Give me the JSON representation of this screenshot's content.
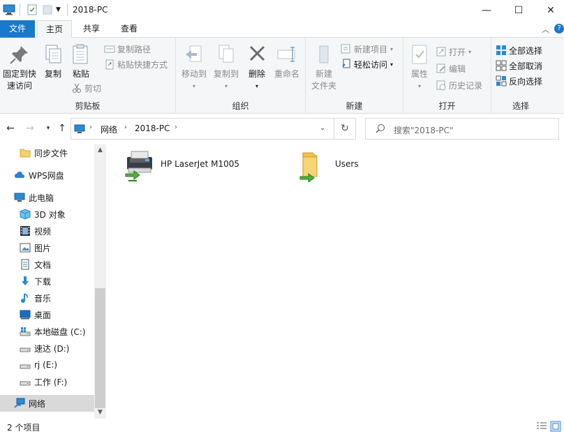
{
  "window": {
    "title": "2018-PC",
    "minimize": "—",
    "maximize": "☐",
    "close": "✕"
  },
  "ribbon_tabs": {
    "file": "文件",
    "home": "主页",
    "share": "共享",
    "view": "查看"
  },
  "clipboard": {
    "pin": "固定到快速访问",
    "pin_line1": "固定到快",
    "pin_line2": "速访问",
    "copy": "复制",
    "paste": "粘贴",
    "copy_path": "复制路径",
    "paste_shortcut": "粘贴快捷方式",
    "cut": "剪切",
    "group": "剪贴板"
  },
  "organize": {
    "move_to": "移动到",
    "copy_to": "复制到",
    "delete": "删除",
    "rename": "重命名",
    "group": "组织"
  },
  "new": {
    "new_folder_line1": "新建",
    "new_folder_line2": "文件夹",
    "new_item": "新建项目",
    "easy_access": "轻松访问",
    "group": "新建"
  },
  "open": {
    "properties": "属性",
    "open": "打开",
    "edit": "编辑",
    "history": "历史记录",
    "group": "打开"
  },
  "select": {
    "select_all": "全部选择",
    "select_none": "全部取消",
    "invert": "反向选择",
    "group": "选择"
  },
  "address": {
    "crumbs": [
      "网络",
      "2018-PC"
    ]
  },
  "search": {
    "placeholder": "搜索\"2018-PC\""
  },
  "nav_pane": {
    "items": [
      {
        "label": "同步文件",
        "icon": "folder-icon"
      },
      {
        "label": "WPS网盘",
        "icon": "cloud-icon"
      },
      {
        "label": "此电脑",
        "icon": "computer-icon"
      },
      {
        "label": "3D 对象",
        "icon": "3d-objects-icon"
      },
      {
        "label": "视频",
        "icon": "video-icon"
      },
      {
        "label": "图片",
        "icon": "pictures-icon"
      },
      {
        "label": "文档",
        "icon": "documents-icon"
      },
      {
        "label": "下载",
        "icon": "download-icon"
      },
      {
        "label": "音乐",
        "icon": "music-icon"
      },
      {
        "label": "桌面",
        "icon": "desktop-icon"
      },
      {
        "label": "本地磁盘 (C:)",
        "icon": "drive-c-icon"
      },
      {
        "label": "速达 (D:)",
        "icon": "drive-icon"
      },
      {
        "label": "rj (E:)",
        "icon": "drive-icon"
      },
      {
        "label": "工作 (F:)",
        "icon": "drive-icon"
      },
      {
        "label": "网络",
        "icon": "network-icon"
      }
    ]
  },
  "content": {
    "items": [
      {
        "label": "HP LaserJet M1005",
        "icon": "network-printer-icon"
      },
      {
        "label": "Users",
        "icon": "shared-folder-icon"
      }
    ]
  },
  "status": {
    "count": "2 个项目"
  },
  "colors": {
    "accent": "#1979ca",
    "selected_nav": "#d9d9d9",
    "ribbon_bg": "#f5f6f7"
  }
}
